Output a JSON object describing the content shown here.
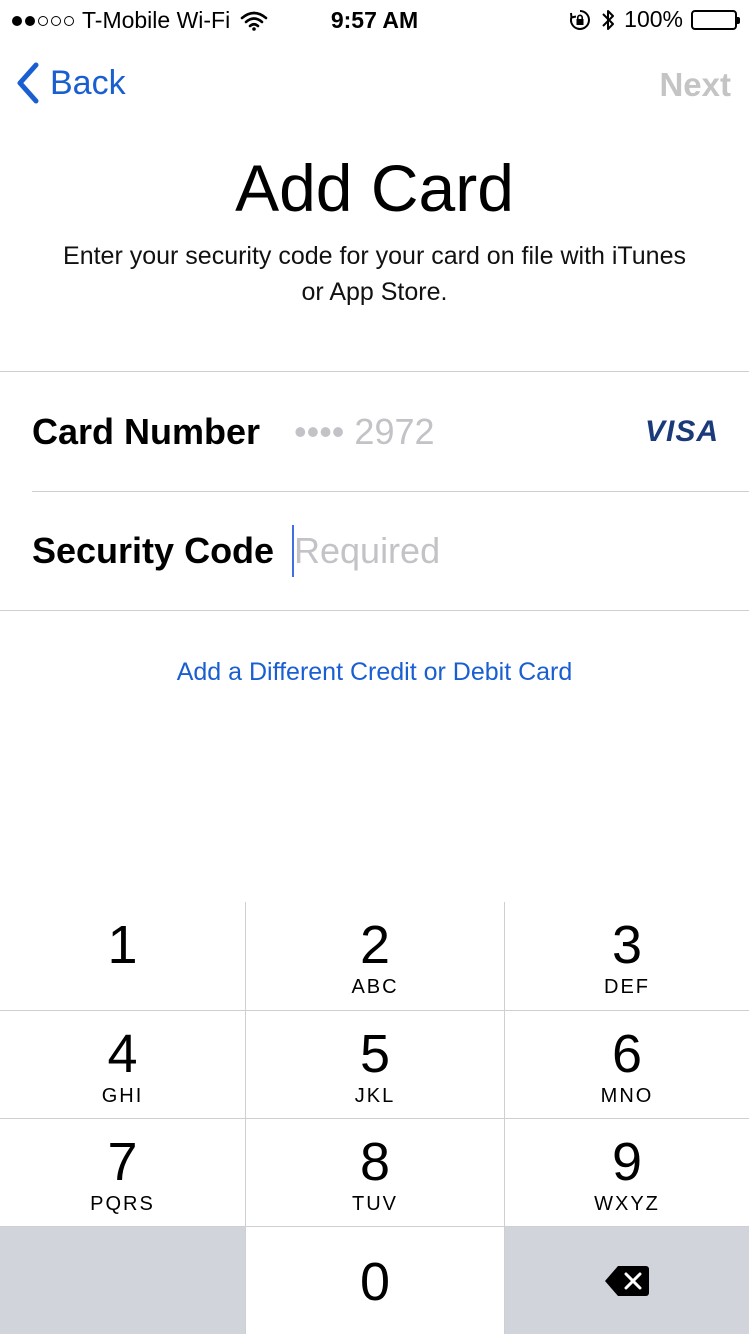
{
  "status": {
    "carrier": "T-Mobile Wi-Fi",
    "time": "9:57 AM",
    "battery": "100%",
    "signal_bars_filled": 2,
    "signal_bars_total": 5
  },
  "nav": {
    "back_label": "Back",
    "next_label": "Next"
  },
  "page": {
    "title": "Add Card",
    "subtitle": "Enter your security code for your card on file with iTunes or App Store."
  },
  "form": {
    "card_number_label": "Card Number",
    "card_number_value": "•••• 2972",
    "card_brand": "VISA",
    "security_code_label": "Security Code",
    "security_code_placeholder": "Required"
  },
  "link": {
    "different_card": "Add a Different Credit or Debit Card"
  },
  "keypad": {
    "keys": [
      {
        "num": "1",
        "letters": ""
      },
      {
        "num": "2",
        "letters": "ABC"
      },
      {
        "num": "3",
        "letters": "DEF"
      },
      {
        "num": "4",
        "letters": "GHI"
      },
      {
        "num": "5",
        "letters": "JKL"
      },
      {
        "num": "6",
        "letters": "MNO"
      },
      {
        "num": "7",
        "letters": "PQRS"
      },
      {
        "num": "8",
        "letters": "TUV"
      },
      {
        "num": "9",
        "letters": "WXYZ"
      },
      {
        "num": "0",
        "letters": ""
      }
    ]
  },
  "icons": {
    "back": "chevron-left-icon",
    "wifi": "wifi-icon",
    "rotation_lock": "rotation-lock-icon",
    "bluetooth": "bluetooth-icon",
    "battery": "battery-icon",
    "delete": "backspace-icon"
  },
  "colors": {
    "accent": "#1a5fd1",
    "disabled": "#c4c4c4",
    "placeholder": "#c2c2c7",
    "keypad_gray": "#d1d5db",
    "visa": "#1a3a7a"
  }
}
